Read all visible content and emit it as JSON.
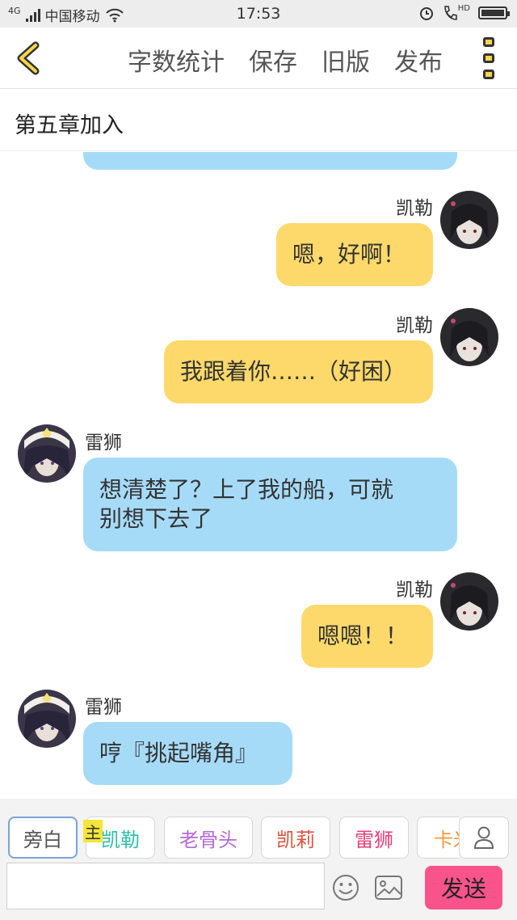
{
  "status_bar": {
    "network": "4G",
    "carrier": "中国移动",
    "time": "17:53",
    "hd": "HD"
  },
  "toolbar": {
    "word_count": "字数统计",
    "save": "保存",
    "old_version": "旧版",
    "publish": "发布"
  },
  "chapter": {
    "title": "第五章加入"
  },
  "messages": [
    {
      "speaker": "凯勒",
      "text": "嗯，好啊！",
      "side": "right"
    },
    {
      "speaker": "凯勒",
      "text": "我跟着你……（好困）",
      "side": "right"
    },
    {
      "speaker": "雷狮",
      "text_line1": "想清楚了？上了我的船，可就",
      "text_line2": "别想下去了",
      "side": "left"
    },
    {
      "speaker": "凯勒",
      "text": "嗯嗯！！",
      "side": "right"
    },
    {
      "speaker": "雷狮",
      "text": "哼『挑起嘴角』",
      "side": "left"
    }
  ],
  "characters": {
    "narration": "旁白",
    "main_tag": "主",
    "items": [
      {
        "label": "凯勒",
        "color": "#2bbfa8"
      },
      {
        "label": "老骨头",
        "color": "#b66ad6"
      },
      {
        "label": "凯莉",
        "color": "#e2503c"
      },
      {
        "label": "雷狮",
        "color": "#e83e7a"
      },
      {
        "label": "卡米",
        "color": "#f29a3a"
      }
    ]
  },
  "composer": {
    "input_value": "",
    "send": "发送"
  },
  "colors": {
    "accent_yellow": "#f7d64a",
    "bubble_blue": "#a6dbf8",
    "bubble_yellow": "#fcd96a",
    "send_pink": "#f9538b"
  }
}
